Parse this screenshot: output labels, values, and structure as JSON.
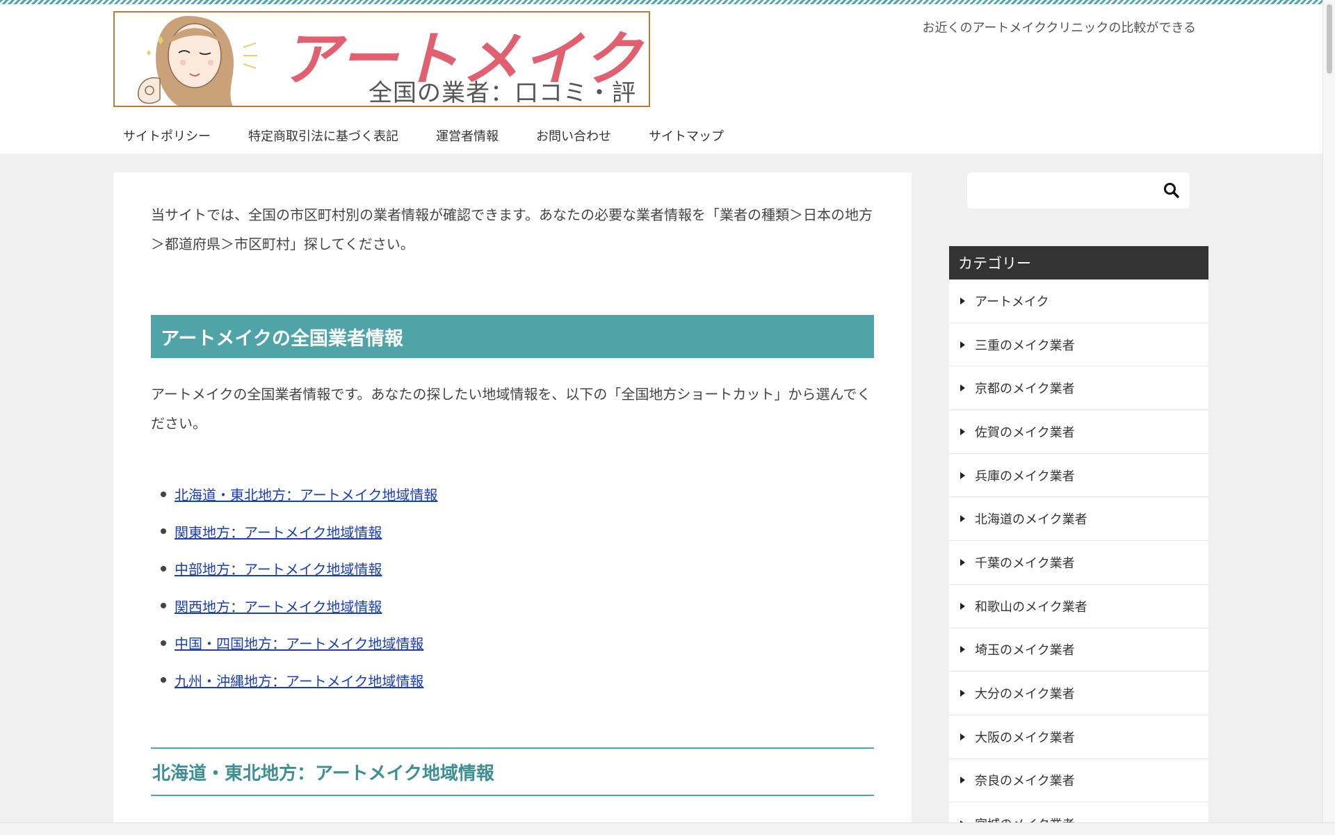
{
  "header": {
    "logo": {
      "title": "アートメイク",
      "subtitle": "全国の業者：口コミ・評判"
    },
    "tagline": "お近くのアートメイククリニックの比較ができる",
    "nav": [
      {
        "label": "サイトポリシー"
      },
      {
        "label": "特定商取引法に基づく表記"
      },
      {
        "label": "運営者情報"
      },
      {
        "label": "お問い合わせ"
      },
      {
        "label": "サイトマップ"
      }
    ]
  },
  "main": {
    "intro": "当サイトでは、全国の市区町村別の業者情報が確認できます。あなたの必要な業者情報を「業者の種類＞日本の地方＞都道府県＞市区町村」探してください。",
    "heading": "アートメイクの全国業者情報",
    "description": "アートメイクの全国業者情報です。あなたの探したい地域情報を、以下の「全国地方ショートカット」から選んでください。",
    "region_links": [
      {
        "label": "北海道・東北地方：アートメイク地域情報"
      },
      {
        "label": "関東地方：アートメイク地域情報"
      },
      {
        "label": "中部地方：アートメイク地域情報"
      },
      {
        "label": "関西地方：アートメイク地域情報"
      },
      {
        "label": "中国・四国地方：アートメイク地域情報"
      },
      {
        "label": "九州・沖縄地方：アートメイク地域情報"
      }
    ],
    "subheading": "北海道・東北地方：アートメイク地域情報"
  },
  "sidebar": {
    "search": {
      "value": "",
      "icon": "search-icon"
    },
    "category_title": "カテゴリー",
    "categories": [
      {
        "label": "アートメイク"
      },
      {
        "label": "三重のメイク業者"
      },
      {
        "label": "京都のメイク業者"
      },
      {
        "label": "佐賀のメイク業者"
      },
      {
        "label": "兵庫のメイク業者"
      },
      {
        "label": "北海道のメイク業者"
      },
      {
        "label": "千葉のメイク業者"
      },
      {
        "label": "和歌山のメイク業者"
      },
      {
        "label": "埼玉のメイク業者"
      },
      {
        "label": "大分のメイク業者"
      },
      {
        "label": "大阪のメイク業者"
      },
      {
        "label": "奈良のメイク業者"
      },
      {
        "label": "宮城のメイク業者"
      }
    ]
  },
  "colors": {
    "accent": "#4fa4a8",
    "link": "#1a3fb5",
    "logo_title": "#e06070",
    "category_header": "#333333"
  }
}
